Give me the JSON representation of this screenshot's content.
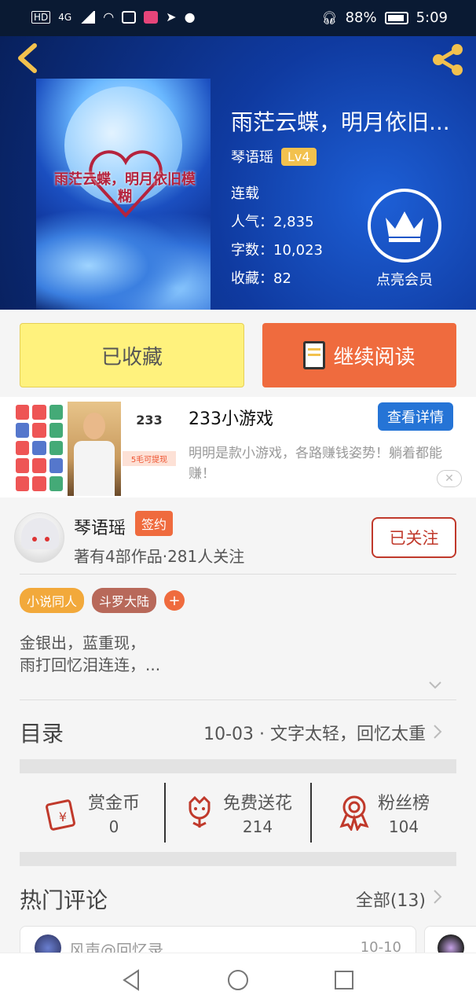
{
  "status_bar": {
    "left_icons": [
      "hd-icon",
      "signal-4g-icon",
      "wifi-icon",
      "activity-icon",
      "app-icon",
      "send-icon",
      "qq-icon"
    ],
    "network": "4G",
    "battery": "88%",
    "time": "5:09"
  },
  "book": {
    "title": "雨茫云蝶，明月依旧...",
    "author": "琴语瑶",
    "level": "Lv4",
    "status": "连载",
    "popularity": "人气：2,835",
    "words": "字数：10,023",
    "favorites": "收藏：82",
    "cover_text": "雨茫云蝶，明月依旧模糊",
    "vip_label": "点亮会员"
  },
  "actions": {
    "collected_label": "已收藏",
    "continue_label": "继续阅读"
  },
  "ad": {
    "thumb_title": "233",
    "thumb_line": "5毛可提现",
    "title": "233小游戏",
    "detail_label": "查看详情",
    "desc": "明明是款小游戏，各路赚钱姿势！躺着都能赚！",
    "close_label": "✕"
  },
  "author_info": {
    "name": "琴语瑶",
    "badge": "签约",
    "summary": "著有4部作品·281人关注",
    "follow_label": "已关注"
  },
  "tags": [
    {
      "label": "小说同人",
      "color": "#f2a93b"
    },
    {
      "label": "斗罗大陆",
      "color": "#b8695a"
    }
  ],
  "tag_add": "+",
  "intro": {
    "line1": "金银出，蓝重现，",
    "line2": "雨打回忆泪连连，..."
  },
  "toc": {
    "label": "目录",
    "latest": "10-03 · 文字太轻，回忆太重"
  },
  "stats": [
    {
      "name": "赏金币",
      "value": "0",
      "icon": "red-envelope-icon"
    },
    {
      "name": "免费送花",
      "value": "214",
      "icon": "flower-icon"
    },
    {
      "name": "粉丝榜",
      "value": "104",
      "icon": "medal-icon"
    }
  ],
  "comments": {
    "title": "热门评论",
    "all_label": "全部(13)",
    "first_user": "风声@回忆录",
    "first_date": "10-10"
  },
  "colors": {
    "accent": "#ef6b3e",
    "collected_bg": "#fff27d",
    "follow": "#c0392b",
    "ad_button": "#2574d6"
  }
}
